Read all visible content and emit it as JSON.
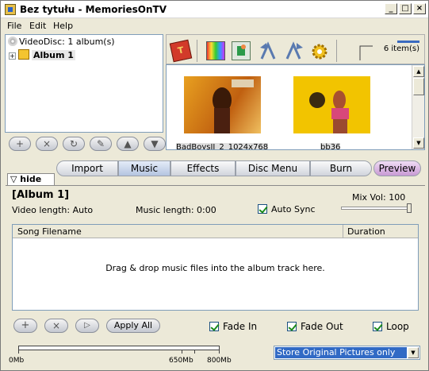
{
  "window": {
    "title": "Bez tytułu - MemoriesOnTV",
    "min": "_",
    "max": "□",
    "close": "×"
  },
  "menu": [
    "File",
    "Edit",
    "Help"
  ],
  "tree": {
    "root": "VideoDisc: 1 album(s)",
    "album": "Album 1",
    "expander": "+"
  },
  "toolbar": {
    "items_count": "6 item(s)",
    "text_icon": "T"
  },
  "thumbnails": [
    {
      "caption": "BadBoysII_2_1024x768",
      "colors": {
        "bg": "#c87a10",
        "fg": "#3a1a08"
      }
    },
    {
      "caption": "bb36",
      "colors": {
        "bg": "#f2c400",
        "fg": "#d8487a"
      }
    }
  ],
  "tabs": {
    "hide": "hide",
    "items": [
      "Import",
      "Music",
      "Effects",
      "Disc Menu",
      "Burn"
    ],
    "active": "Music",
    "preview": "Preview"
  },
  "music": {
    "album_title": "[Album 1]",
    "mix_vol_label": "Mix Vol: 100",
    "mix_vol": 100,
    "video_length": "Video length: Auto",
    "music_length": "Music length:  0:00",
    "auto_sync": "Auto Sync",
    "columns": [
      "Song Filename",
      "Duration"
    ],
    "empty_text": "Drag & drop music files into the album track here.",
    "apply_all": "Apply All",
    "fade_in": "Fade In",
    "fade_out": "Fade Out",
    "loop": "Loop"
  },
  "capacity": {
    "labels": [
      "0Mb",
      "650Mb",
      "800Mb"
    ],
    "used_fraction": 0.0
  },
  "storage_option": "Store Original Pictures only",
  "colors": {
    "accent": "#316ac5",
    "active_tab": "#b4c4e0",
    "preview_tab": "#c89ad4"
  }
}
